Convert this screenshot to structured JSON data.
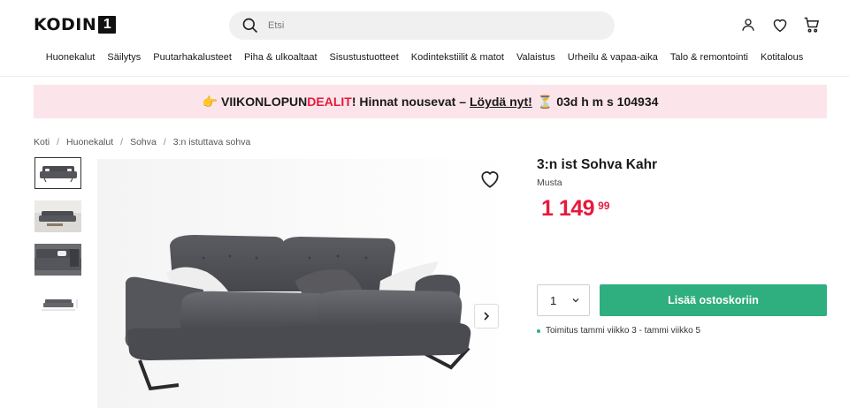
{
  "header": {
    "logo_text": "KODIN",
    "logo_box": "1",
    "search_placeholder": "Etsi",
    "icons": [
      "user-icon",
      "heart-icon",
      "cart-icon"
    ]
  },
  "nav": [
    "Huonekalut",
    "Säilytys",
    "Puutarhakalusteet",
    "Piha & ulkoaltaat",
    "Sisustustuotteet",
    "Kodintekstiilit & matot",
    "Valaistus",
    "Urheilu & vapaa-aika",
    "Talo & remontointi",
    "Kotitalous"
  ],
  "promo": {
    "emoji": "👉",
    "part1": "VIIKONLOPUN ",
    "deal": "DEALIT",
    "part2": "! Hinnat nousevat – ",
    "link": "Löydä nyt!",
    "hourglass": "⏳",
    "countdown": "03d h m s 104934"
  },
  "breadcrumb": [
    "Koti",
    "Huonekalut",
    "Sohva",
    "3:n istuttava sohva"
  ],
  "product": {
    "title": "3:n ist Sohva Kahr",
    "color": "Musta",
    "price_int": "1 149",
    "price_dec": "99",
    "quantity": "1",
    "add_label": "Lisää ostoskoriin",
    "delivery": "Toimitus tammi viikko 3 - tammi viikko 5"
  },
  "colors": {
    "accent_red": "#e8193c",
    "cta_green": "#2fae7f",
    "promo_bg": "#fbe5ea"
  }
}
